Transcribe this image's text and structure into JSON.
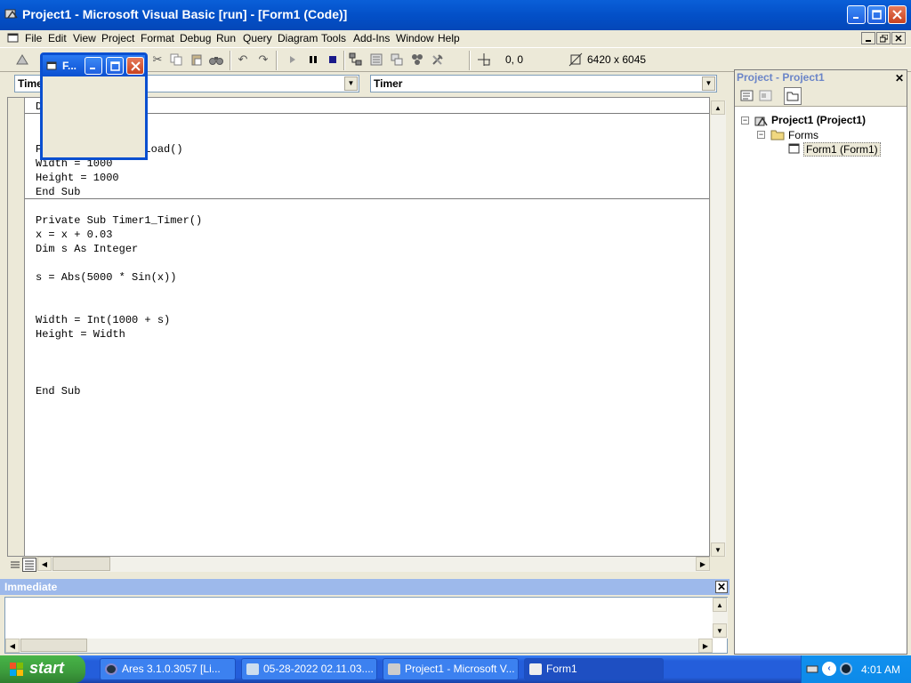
{
  "window": {
    "title": "Project1 - Microsoft Visual Basic [run] - [Form1 (Code)]"
  },
  "menu": {
    "items": [
      "File",
      "Edit",
      "View",
      "Project",
      "Format",
      "Debug",
      "Run",
      "Query",
      "Diagram",
      "Tools",
      "Add-Ins",
      "Window",
      "Help"
    ]
  },
  "toolbar": {
    "position": "0, 0",
    "size": "6420 x 6045"
  },
  "code_window": {
    "object_combo": "Timer",
    "procedure_combo": "Timer",
    "lines": [
      "Private Sub Form_Load()",
      "Width = 1000",
      "Height = 1000",
      "End Sub",
      "Private Sub Timer1_Timer()",
      "x = x + 0.03",
      "Dim s As Integer",
      "s = Abs(5000 * Sin(x))",
      "Width = Int(1000 + s)",
      "Height = Width",
      "End Sub"
    ]
  },
  "form1_window": {
    "title": "F..."
  },
  "project_explorer": {
    "title": "Project - Project1",
    "root": "Project1 (Project1)",
    "folder": "Forms",
    "item": "Form1 (Form1)"
  },
  "immediate": {
    "title": "Immediate"
  },
  "taskbar": {
    "start_label": "start",
    "tasks": [
      "Ares 3.1.0.3057   [Li...",
      "05-28-2022 02.11.03....",
      "Project1 - Microsoft V...",
      "Form1"
    ],
    "clock": "4:01 AM"
  }
}
